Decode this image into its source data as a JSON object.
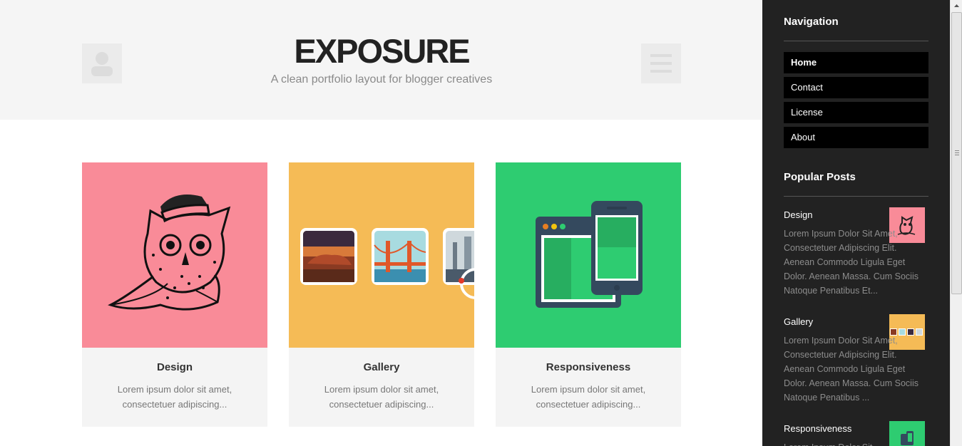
{
  "header": {
    "site_title": "EXPOSURE",
    "site_description": "A clean portfolio layout for blogger creatives"
  },
  "cards": [
    {
      "title": "Design",
      "excerpt": "Lorem ipsum dolor sit amet, consectetuer adipiscing...",
      "color": "#f98b98"
    },
    {
      "title": "Gallery",
      "excerpt": "Lorem ipsum dolor sit amet, consectetuer adipiscing...",
      "color": "#f5bb56"
    },
    {
      "title": "Responsiveness",
      "excerpt": "Lorem ipsum dolor sit amet, consectetuer adipiscing...",
      "color": "#2ecc71"
    }
  ],
  "sidebar": {
    "navigation_heading": "Navigation",
    "nav_items": [
      "Home",
      "Contact",
      "License",
      "About"
    ],
    "popular_heading": "Popular Posts",
    "posts": [
      {
        "title": "Design",
        "excerpt": "Lorem Ipsum Dolor Sit Amet, Consectetuer Adipiscing Elit. Aenean Commodo Ligula Eget Dolor. Aenean Massa. Cum Sociis Natoque Penatibus Et..."
      },
      {
        "title": "Gallery",
        "excerpt": "Lorem Ipsum Dolor Sit Amet, Consectetuer Adipiscing Elit. Aenean Commodo Ligula Eget Dolor. Aenean Massa. Cum Sociis Natoque Penatibus ..."
      },
      {
        "title": "Responsiveness",
        "excerpt": "Lorem Ipsum Dolor Sit"
      }
    ]
  },
  "colors": {
    "header_bg": "#f5f5f5",
    "sidebar_bg": "#222222",
    "nav_item_bg": "#000000",
    "card_bg": "#f4f4f4",
    "pink": "#f98b98",
    "yellow": "#f5bb56",
    "green": "#2ecc71"
  },
  "icons": [
    "user-icon",
    "hamburger-menu-icon",
    "owl-illustration",
    "landscape-photo-icons",
    "devices-illustration"
  ]
}
